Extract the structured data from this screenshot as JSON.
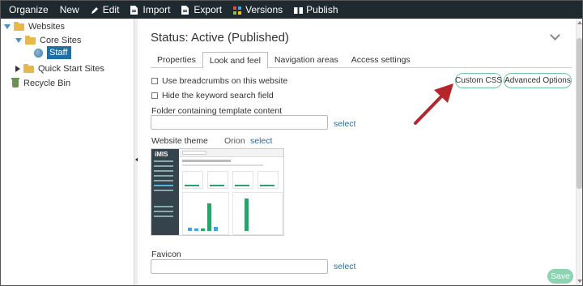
{
  "toolbar": {
    "organize": "Organize",
    "new": "New",
    "edit": "Edit",
    "import": "Import",
    "export": "Export",
    "versions": "Versions",
    "publish": "Publish"
  },
  "tree": {
    "websites": "Websites",
    "core_sites": "Core Sites",
    "staff": "Staff",
    "quick_start_sites": "Quick Start Sites",
    "recycle_bin": "Recycle Bin"
  },
  "main": {
    "status": "Status: Active (Published)",
    "tabs": [
      "Properties",
      "Look and feel",
      "Navigation areas",
      "Access settings"
    ],
    "active_tab": "Look and feel",
    "breadcrumbs_label": "Use breadcrumbs on this website",
    "hide_search_label": "Hide the keyword search field",
    "custom_css_button": "Custom CSS",
    "advanced_options_button": "Advanced Options",
    "folder_label": "Folder containing template content",
    "folder_value": "",
    "select_link": "select",
    "theme_label": "Website theme",
    "theme_value": "Orion",
    "theme_select_link": "select",
    "favicon_label": "Favicon",
    "favicon_value": "",
    "favicon_select_link": "select",
    "save_button": "Save"
  },
  "thumbnail": {
    "logo": "iMIS"
  },
  "colors": {
    "toolbar_bg": "#1f2a30",
    "accent_green": "#6cc6a0",
    "save_green": "#8dd3b2",
    "selected_blue": "#1e6fa6",
    "link_blue": "#2c6aa0",
    "annotation_red": "#b5262a"
  }
}
